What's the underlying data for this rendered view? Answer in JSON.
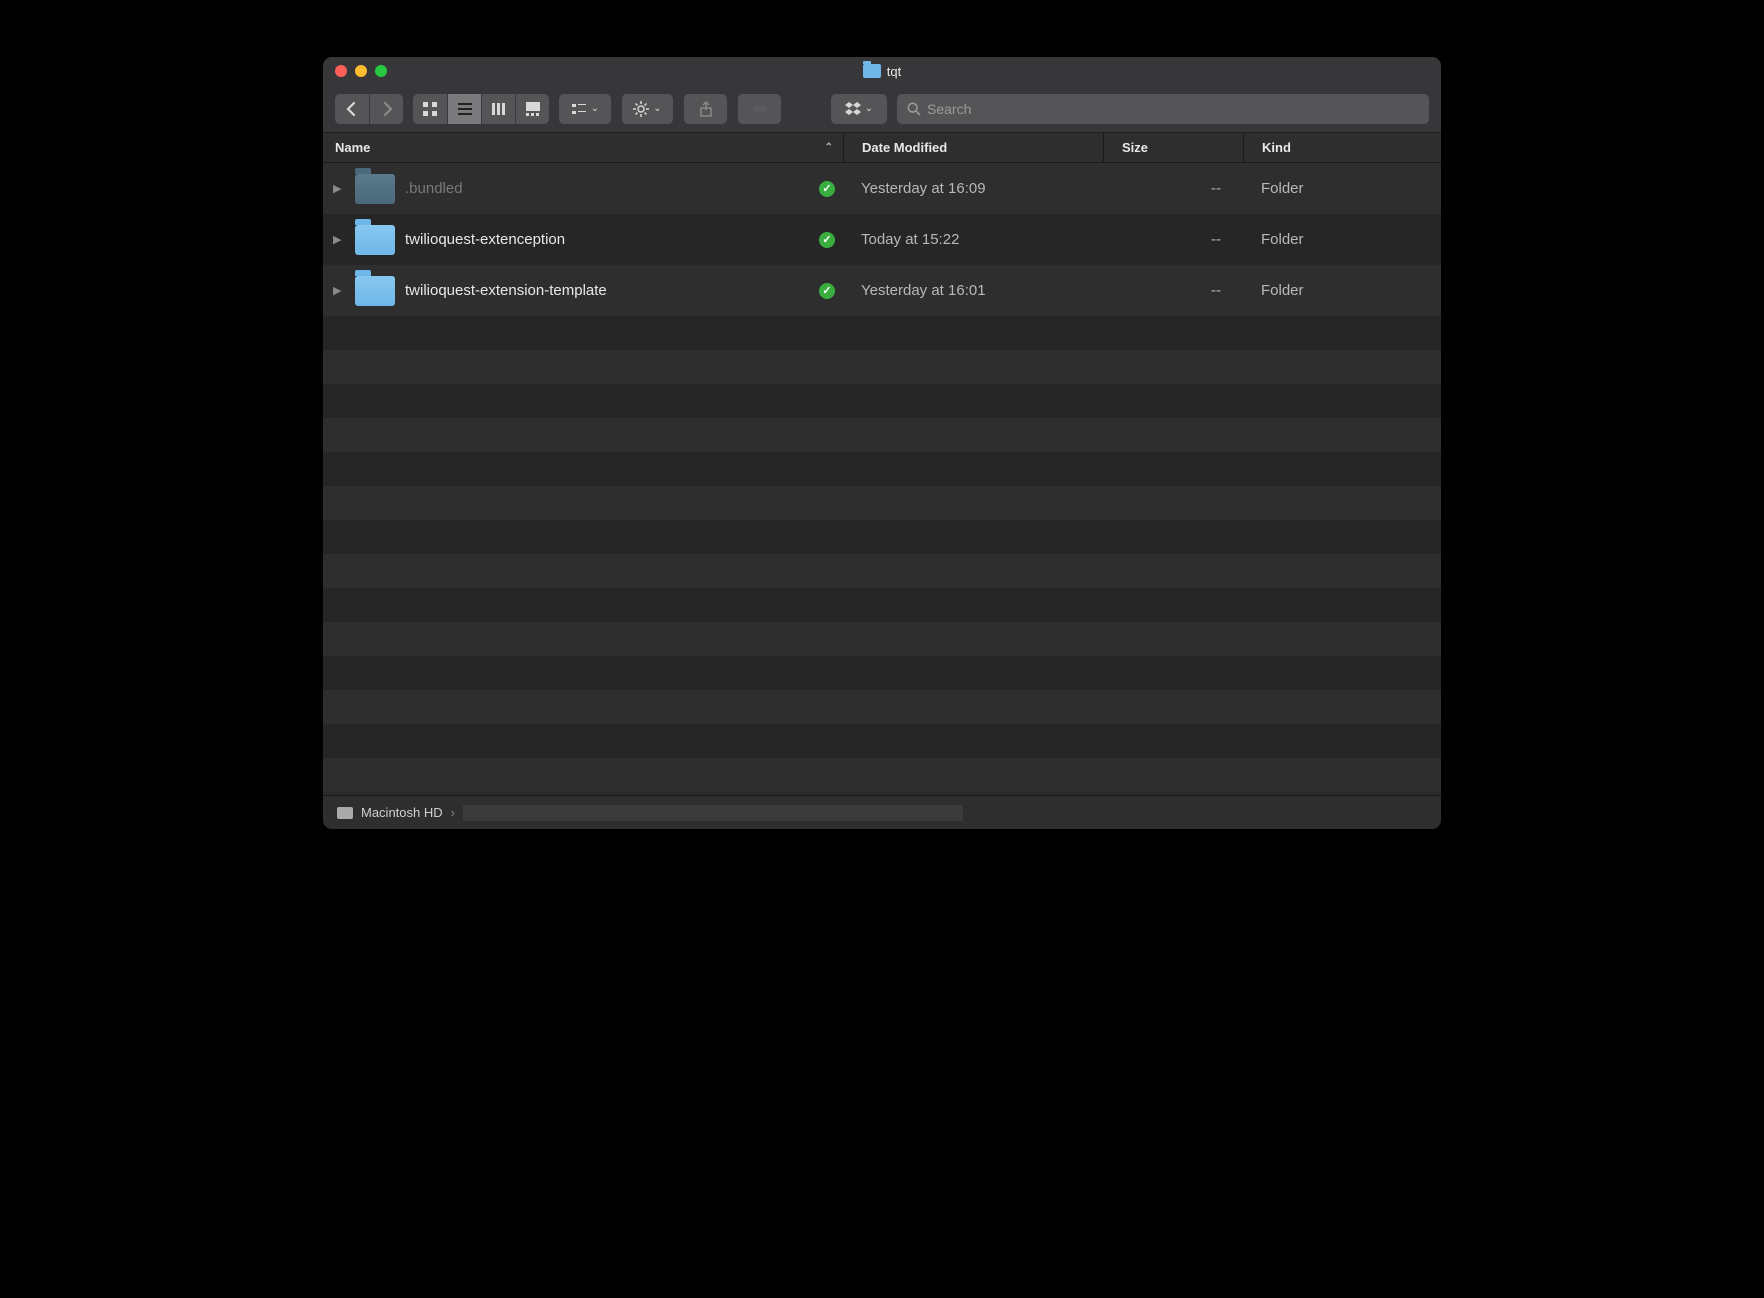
{
  "title": "tqt",
  "search_placeholder": "Search",
  "columns": {
    "name": "Name",
    "date": "Date Modified",
    "size": "Size",
    "kind": "Kind"
  },
  "rows": [
    {
      "name": ".bundled",
      "dim": true,
      "date": "Yesterday at 16:09",
      "size": "--",
      "kind": "Folder",
      "synced": true
    },
    {
      "name": "twilioquest-extenception",
      "dim": false,
      "date": "Today at 15:22",
      "size": "--",
      "kind": "Folder",
      "synced": true
    },
    {
      "name": "twilioquest-extension-template",
      "dim": false,
      "date": "Yesterday at 16:01",
      "size": "--",
      "kind": "Folder",
      "synced": true
    }
  ],
  "pathbar": {
    "root": "Macintosh HD",
    "sep": "›"
  }
}
